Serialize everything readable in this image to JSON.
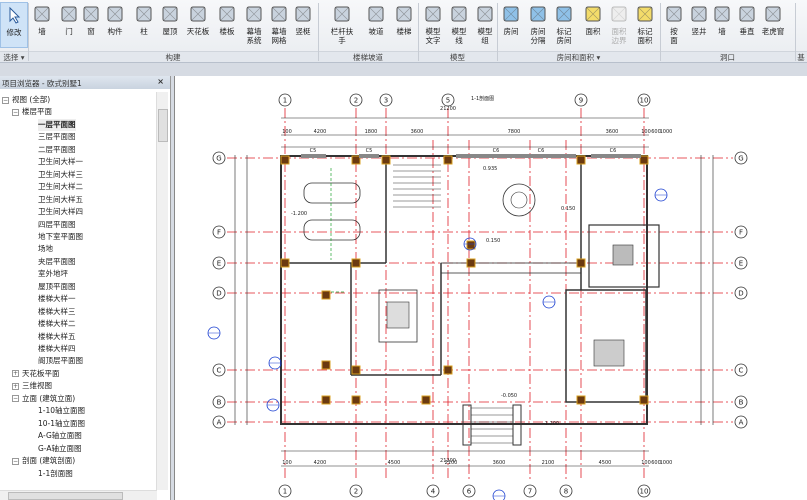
{
  "ribbon": {
    "buttons": [
      {
        "id": "modify",
        "label": "修改",
        "icon": "cursor-icon",
        "selected": true
      },
      {
        "id": "wall",
        "label": "墙",
        "icon": "wall-icon"
      },
      {
        "id": "door",
        "label": "门",
        "icon": "door-icon"
      },
      {
        "id": "window",
        "label": "窗",
        "icon": "window-icon"
      },
      {
        "id": "component",
        "label": "构件",
        "icon": "component-icon"
      },
      {
        "id": "column",
        "label": "柱",
        "icon": "column-icon"
      },
      {
        "id": "roof",
        "label": "屋顶",
        "icon": "roof-icon"
      },
      {
        "id": "ceiling",
        "label": "天花板",
        "icon": "ceiling-icon"
      },
      {
        "id": "floor",
        "label": "楼板",
        "icon": "floor-icon"
      },
      {
        "id": "curtain-system",
        "label": "幕墙\n系统",
        "icon": "curtain-system-icon"
      },
      {
        "id": "curtain-grid",
        "label": "幕墙\n网格",
        "icon": "curtain-grid-icon"
      },
      {
        "id": "mullion",
        "label": "竖梃",
        "icon": "mullion-icon"
      },
      {
        "id": "railing",
        "label": "栏杆扶手",
        "icon": "railing-icon"
      },
      {
        "id": "ramp",
        "label": "坡道",
        "icon": "ramp-icon"
      },
      {
        "id": "stair",
        "label": "楼梯",
        "icon": "stair-icon"
      },
      {
        "id": "model-text",
        "label": "模型\n文字",
        "icon": "model-text-icon"
      },
      {
        "id": "model-line",
        "label": "模型\n线",
        "icon": "model-line-icon"
      },
      {
        "id": "model-group",
        "label": "模型\n组",
        "icon": "model-group-icon"
      },
      {
        "id": "room",
        "label": "房间",
        "icon": "room-icon"
      },
      {
        "id": "room-separator",
        "label": "房间\n分隔",
        "icon": "room-separator-icon"
      },
      {
        "id": "tag-room",
        "label": "标记\n房间",
        "icon": "tag-room-icon"
      },
      {
        "id": "area",
        "label": "面积",
        "icon": "area-icon"
      },
      {
        "id": "area-boundary",
        "label": "面积\n边界",
        "icon": "area-boundary-icon",
        "disabled": true
      },
      {
        "id": "tag-area",
        "label": "标记\n面积",
        "icon": "tag-area-icon"
      },
      {
        "id": "by-face",
        "label": "按\n面",
        "icon": "by-face-icon"
      },
      {
        "id": "shaft",
        "label": "竖井",
        "icon": "shaft-icon"
      },
      {
        "id": "wall-opening",
        "label": "墙",
        "icon": "wall-opening-icon"
      },
      {
        "id": "vertical",
        "label": "垂直",
        "icon": "vertical-opening-icon"
      },
      {
        "id": "dormer",
        "label": "老虎窗",
        "icon": "dormer-icon"
      }
    ],
    "panels": [
      "选择 ▾",
      "构建",
      "楼梯坡道",
      "模型",
      "房间和面积 ▾",
      "洞口",
      "基"
    ]
  },
  "browser": {
    "title": "项目浏览器 - 欧式别墅1",
    "close": "×",
    "items": [
      {
        "label": "视图 (全部)",
        "level": 0,
        "toggle": "−"
      },
      {
        "label": "楼层平面",
        "level": 1,
        "toggle": "−"
      },
      {
        "label": "一层平面图",
        "level": 2,
        "bold": true
      },
      {
        "label": "三层平面图",
        "level": 2
      },
      {
        "label": "二层平面图",
        "level": 2
      },
      {
        "label": "卫生间大样一",
        "level": 2
      },
      {
        "label": "卫生间大样三",
        "level": 2
      },
      {
        "label": "卫生间大样二",
        "level": 2
      },
      {
        "label": "卫生间大样五",
        "level": 2
      },
      {
        "label": "卫生间大样四",
        "level": 2
      },
      {
        "label": "四层平面图",
        "level": 2
      },
      {
        "label": "地下室平面图",
        "level": 2
      },
      {
        "label": "场地",
        "level": 2
      },
      {
        "label": "夹层平面图",
        "level": 2
      },
      {
        "label": "室外地坪",
        "level": 2
      },
      {
        "label": "屋顶平面图",
        "level": 2
      },
      {
        "label": "楼梯大样一",
        "level": 2
      },
      {
        "label": "楼梯大样三",
        "level": 2
      },
      {
        "label": "楼梯大样二",
        "level": 2
      },
      {
        "label": "楼梯大样五",
        "level": 2
      },
      {
        "label": "楼梯大样四",
        "level": 2
      },
      {
        "label": "阁顶层平面图",
        "level": 2
      },
      {
        "label": "天花板平面",
        "level": 1,
        "toggle": "+"
      },
      {
        "label": "三维视图",
        "level": 1,
        "toggle": "+"
      },
      {
        "label": "立面 (建筑立面)",
        "level": 1,
        "toggle": "−"
      },
      {
        "label": "1-10轴立面图",
        "level": 2
      },
      {
        "label": "10-1轴立面图",
        "level": 2
      },
      {
        "label": "A-G轴立面图",
        "level": 2
      },
      {
        "label": "G-A轴立面图",
        "level": 2
      },
      {
        "label": "剖面 (建筑剖面)",
        "level": 1,
        "toggle": "−"
      },
      {
        "label": "1-1剖面图",
        "level": 2
      }
    ]
  },
  "drawing": {
    "top_axes": [
      "1",
      "2",
      "3",
      "5",
      "9",
      "10"
    ],
    "bottom_axes": [
      "1",
      "2",
      "4",
      "6",
      "7",
      "8",
      "10"
    ],
    "side_axes": [
      "G",
      "F",
      "E",
      "D",
      "C",
      "B",
      "A"
    ],
    "overall_dim": "21200",
    "top_dims": [
      "100",
      "4200",
      "1800",
      "3600",
      "7800",
      "3600",
      "100",
      "600",
      "1000"
    ],
    "bottom_dims": [
      "100",
      "4200",
      "4500",
      "2100",
      "3600",
      "2100",
      "4500",
      "100",
      "600",
      "1000"
    ],
    "section_label": "1-1剖面图",
    "levels": [
      "-1.200",
      "0.150",
      "-0.050",
      "-1.200",
      "0.935",
      "0.150"
    ],
    "window_tags": [
      "C5",
      "C5",
      "C6",
      "C6",
      "C6"
    ],
    "colors": {
      "grid_line": "#e0202a",
      "wall": "#333333",
      "column": "#6b3a10",
      "dim": "#222222",
      "bubble": "#333333",
      "tag": "#1a3fd0",
      "green_dash": "#20a030"
    }
  }
}
